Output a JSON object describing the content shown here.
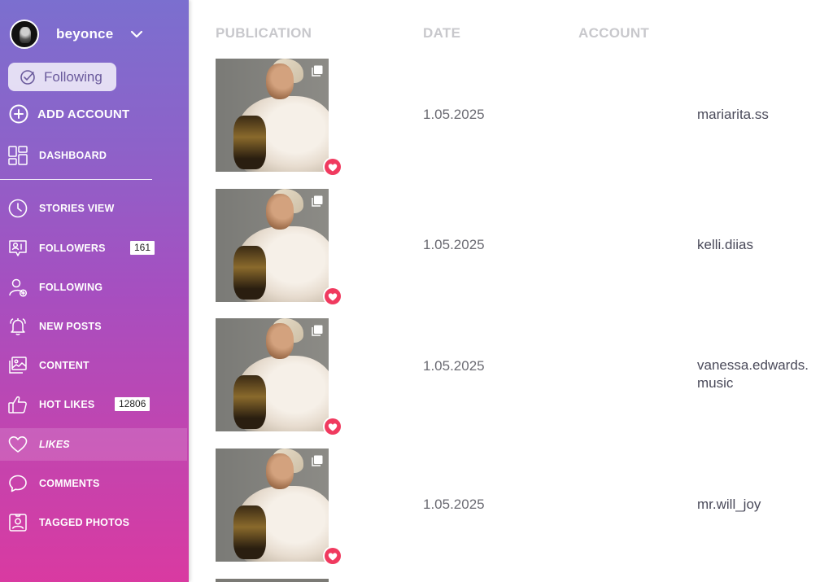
{
  "sidebar": {
    "username": "beyonce",
    "following_label": "Following",
    "add_account_label": "ADD ACCOUNT",
    "items": [
      {
        "label": "DASHBOARD",
        "icon": "dashboard-icon"
      },
      {
        "label": "STORIES VIEW",
        "icon": "clock-icon"
      },
      {
        "label": "FOLLOWERS",
        "icon": "followers-icon",
        "badge": "161"
      },
      {
        "label": "FOLLOWING",
        "icon": "following-icon"
      },
      {
        "label": "NEW POSTS",
        "icon": "bell-icon"
      },
      {
        "label": "CONTENT",
        "icon": "gallery-icon"
      },
      {
        "label": "HOT LIKES",
        "icon": "thumbs-up-icon",
        "badge": "12806"
      },
      {
        "label": "LIKES",
        "icon": "heart-icon",
        "active": true
      },
      {
        "label": "COMMENTS",
        "icon": "comment-icon"
      },
      {
        "label": "TAGGED PHOTOS",
        "icon": "tagged-photo-icon"
      }
    ]
  },
  "table": {
    "headers": {
      "publication": "PUBLICATION",
      "date": "DATE",
      "account": "ACCOUNT"
    },
    "rows": [
      {
        "date": "1.05.2025",
        "account": "mariarita.ss"
      },
      {
        "date": "1.05.2025",
        "account": "kelli.diias"
      },
      {
        "date": "1.05.2025",
        "account": "vanessa.edwards.\nmusic"
      },
      {
        "date": "1.05.2025",
        "account": "mr.will_joy"
      }
    ]
  },
  "colors": {
    "accent_heart": "#f03a5f",
    "header_text": "#c8c8cc"
  }
}
